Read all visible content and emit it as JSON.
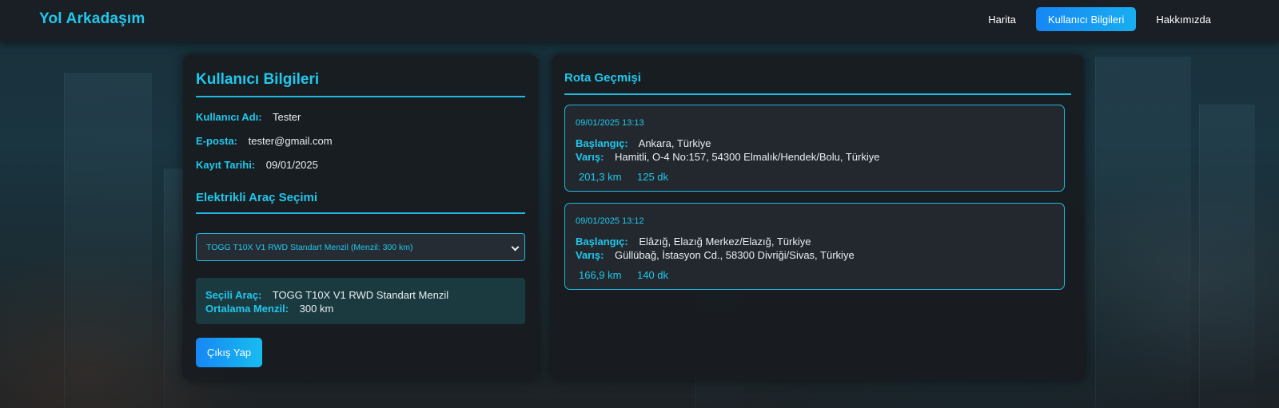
{
  "nav": {
    "brand": "Yol Arkadaşım",
    "links": [
      {
        "label": "Harita",
        "active": false
      },
      {
        "label": "Kullanıcı Bilgileri",
        "active": true
      },
      {
        "label": "Hakkımızda",
        "active": false
      }
    ]
  },
  "user": {
    "title": "Kullanıcı Bilgileri",
    "username_label": "Kullanıcı Adı:",
    "username": "Tester",
    "email_label": "E-posta:",
    "email": "tester@gmail.com",
    "signup_label": "Kayıt Tarihi:",
    "signup_date": "09/01/2025"
  },
  "vehicle": {
    "title": "Elektrikli Araç Seçimi",
    "select_value": "TOGG T10X V1 RWD Standart Menzil (Menzil: 300 km)",
    "selected_label": "Seçili Araç:",
    "selected_name": "TOGG T10X V1 RWD Standart Menzil",
    "range_label": "Ortalama Menzil:",
    "range_value": "300 km"
  },
  "logout_label": "Çıkış Yap",
  "routes": {
    "title": "Rota Geçmişi",
    "start_label": "Başlangıç:",
    "end_label": "Varış:",
    "items": [
      {
        "date": "09/01/2025 13:13",
        "start": "Ankara, Türkiye",
        "end": "Hamitli, O-4 No:157, 54300 Elmalık/Hendek/Bolu, Türkiye",
        "distance": "201,3 km",
        "duration": "125 dk"
      },
      {
        "date": "09/01/2025 13:12",
        "start": "Elâzığ, Elazığ Merkez/Elazığ, Türkiye",
        "end": "Güllübağ, İstasyon Cd., 58300 Divriği/Sivas, Türkiye",
        "distance": "166,9 km",
        "duration": "140 dk"
      }
    ]
  },
  "colors": {
    "accent": "#20c8ec",
    "button_gradient_start": "#1687f5",
    "button_gradient_end": "#18bcf0",
    "card_bg": "#181c20",
    "navbar_bg": "#1a1f25"
  }
}
